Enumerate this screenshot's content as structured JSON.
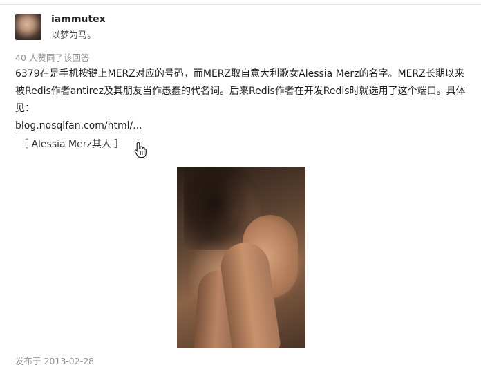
{
  "author": {
    "name": "iammutex",
    "bio": "以梦为马。"
  },
  "votes_text": "40 人赞同了该回答",
  "answer": {
    "text": "6379在是手机按键上MERZ对应的号码，而MERZ取自意大利歌女Alessia Merz的名字。MERZ长期以来被Redis作者antirez及其朋友当作愚蠢的代名词。后来Redis作者在开发Redis时就选用了这个端口。具体见：",
    "link_text": "blog.nosqlfan.com/html/...",
    "bracket_link_text": "［ Alessia Merz其人 ］"
  },
  "footer": {
    "published": "发布于 2013-02-28"
  },
  "icons": {
    "cursor": "hand-pointer-icon"
  }
}
